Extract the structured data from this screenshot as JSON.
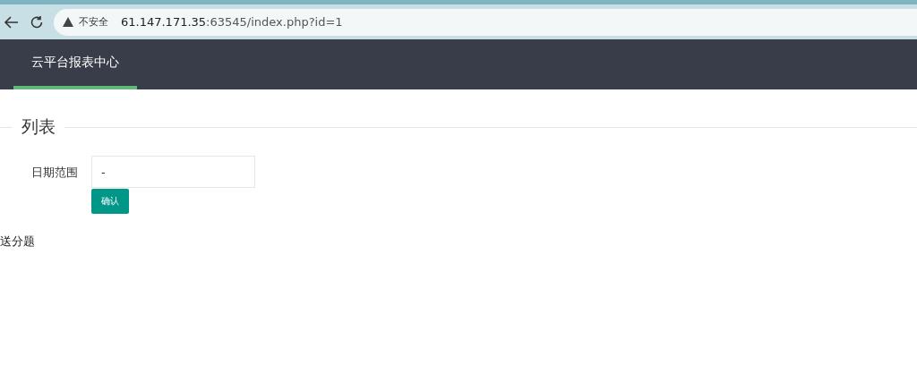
{
  "browser": {
    "security": "不安全",
    "url_host": "61.147.171.35",
    "url_rest": ":63545/index.php?id=1"
  },
  "nav": {
    "items": [
      {
        "label": "云平台报表中心",
        "selected": true
      }
    ]
  },
  "section": {
    "title": "列表"
  },
  "form": {
    "label": "日期范围",
    "value": "-",
    "button": "确认"
  },
  "text": "送分题"
}
